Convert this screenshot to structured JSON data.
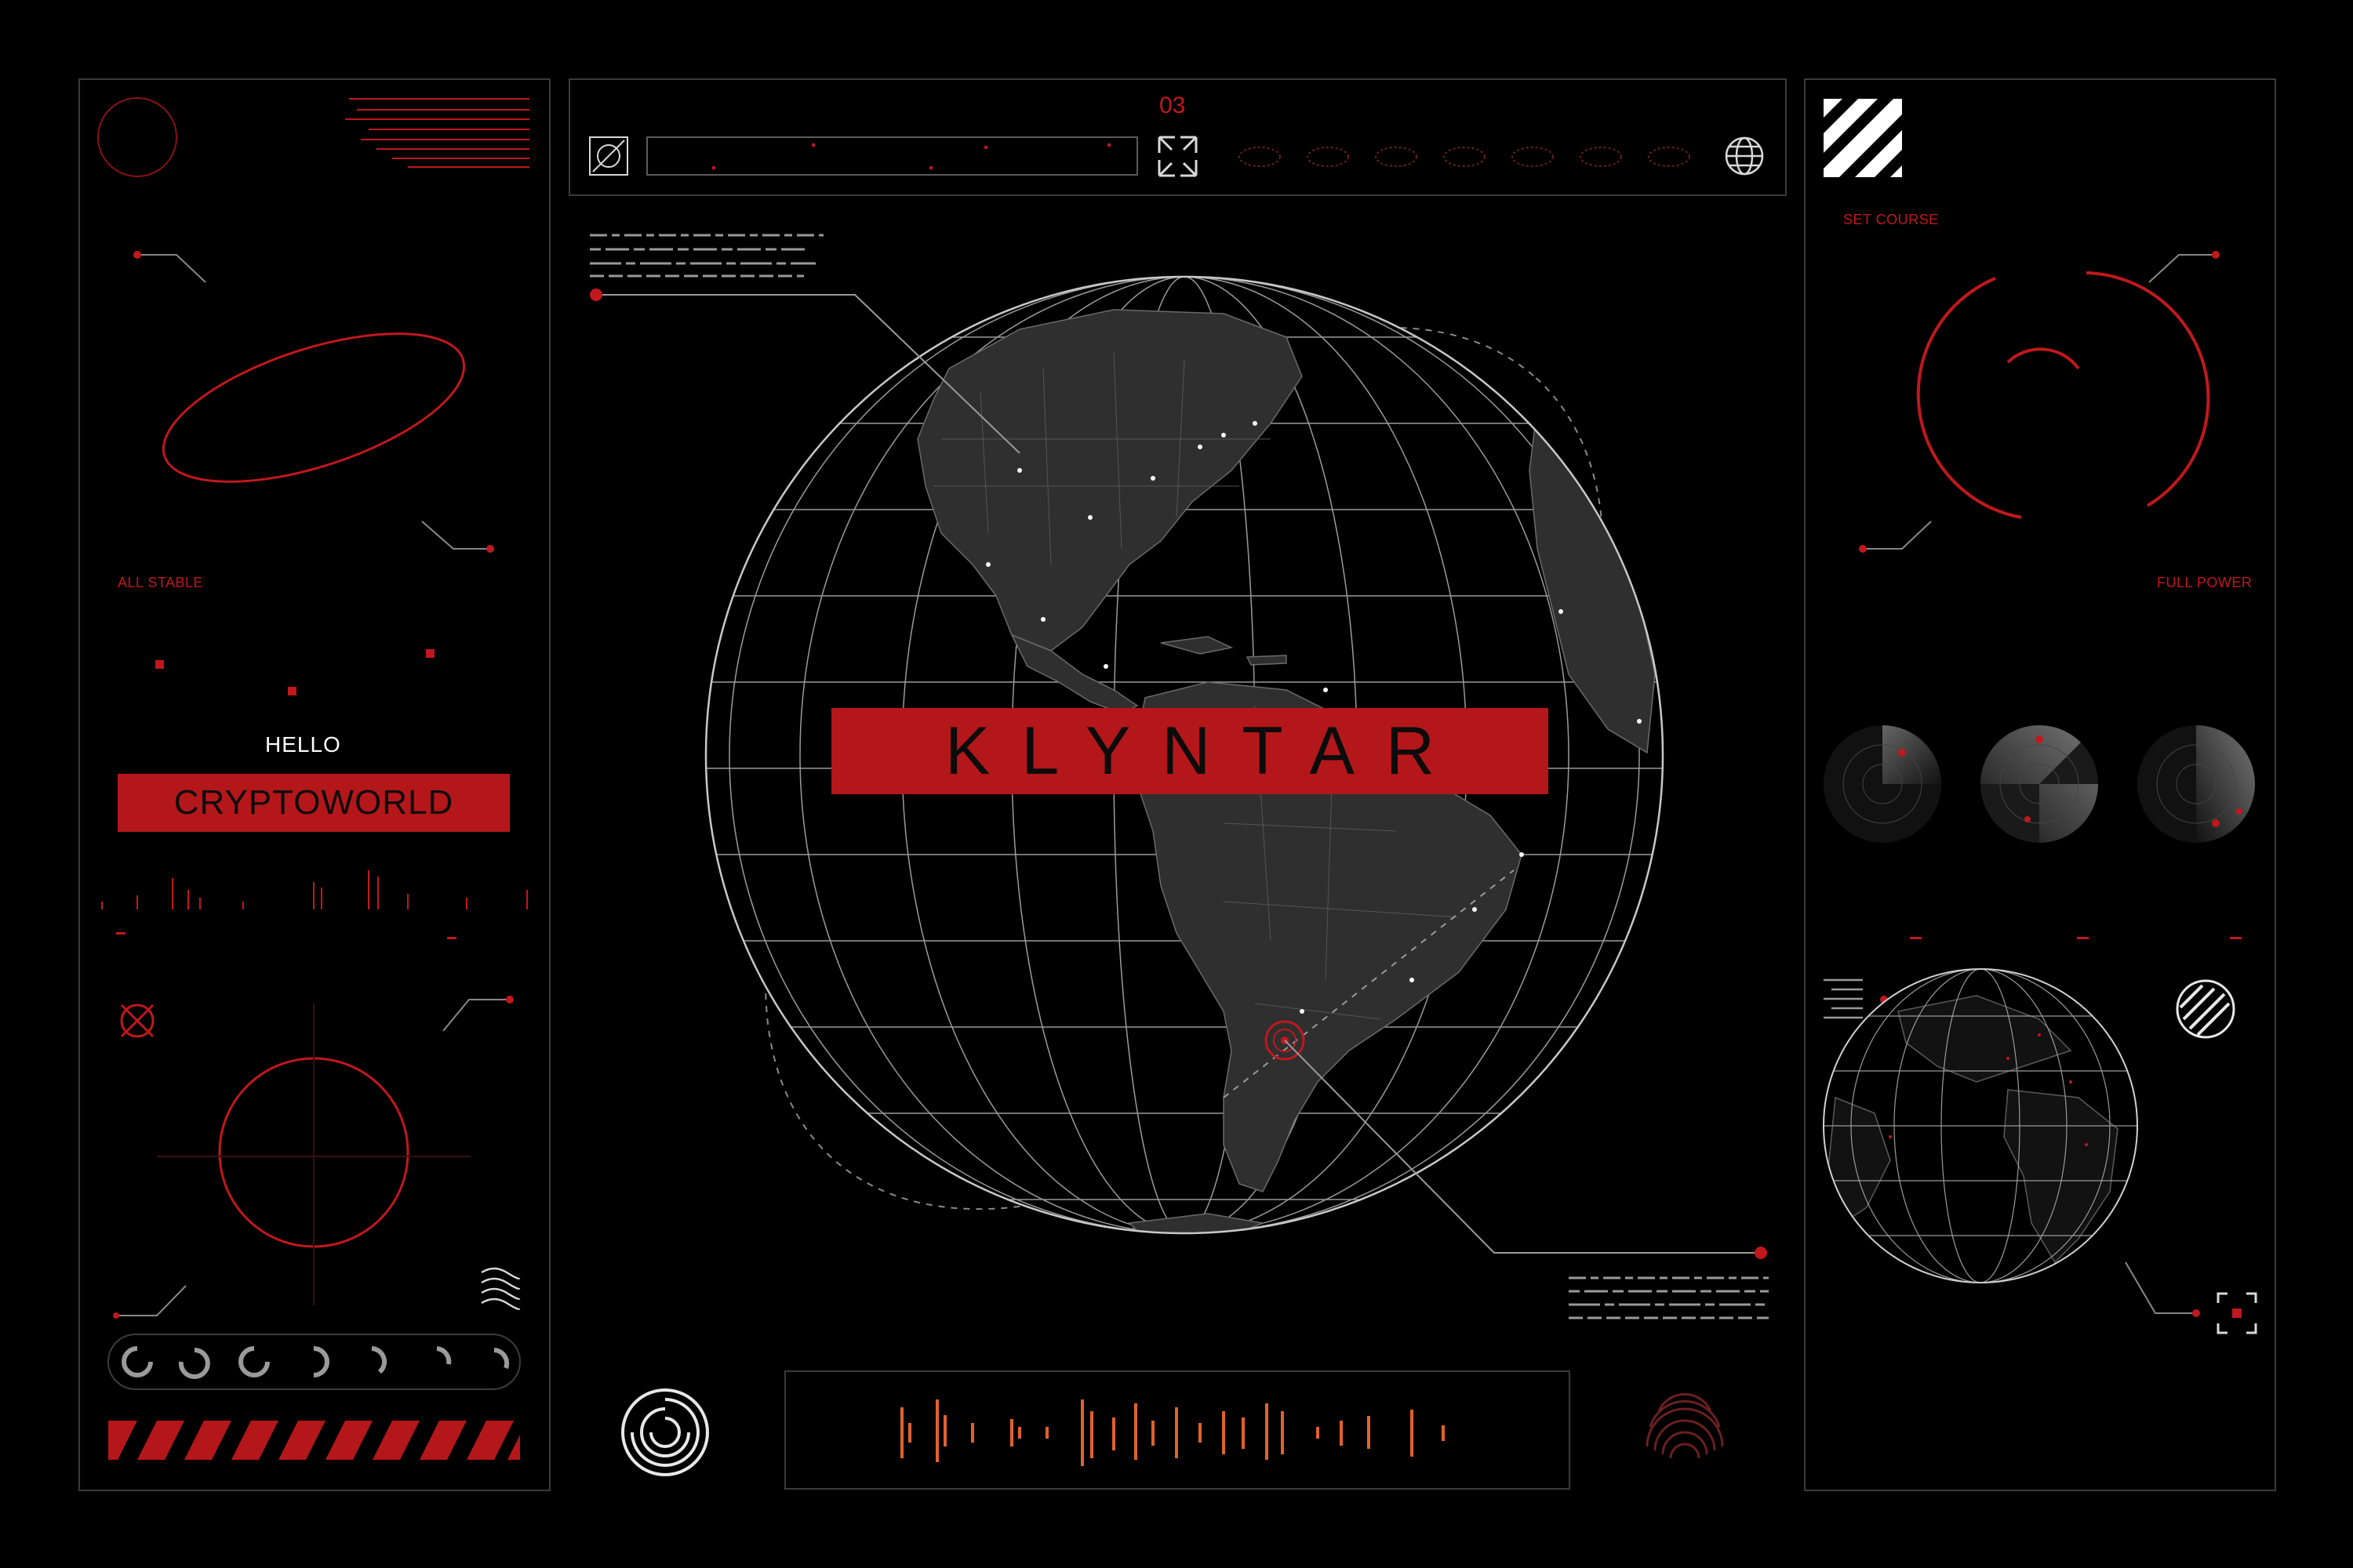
{
  "left_panel": {
    "status": "ALL STABLE",
    "greeting": "HELLO",
    "badge": "CRYPTOWORLD"
  },
  "top_bar": {
    "counter": "03"
  },
  "center": {
    "title": "KLYNTAR"
  },
  "right_panel": {
    "status_left": "SET COURSE",
    "status_right": "FULL POWER"
  },
  "colors": {
    "background": "#000000",
    "accent_red": "#b4171a",
    "line_red": "#c0181d",
    "orange": "#e0622a",
    "panel_border": "#3a3a3a",
    "land": "#303030",
    "grid": "#b8b8b8"
  },
  "icons": {
    "top_left": "crossed-square-icon",
    "top_expand": "expand-arrows-icon",
    "top_globe": "globe-icon",
    "hatched": "hazard-stripes-icon",
    "target": "crosshair-target-icon",
    "waves": "wave-lines-icon",
    "spiral": "spiral-icon",
    "fingerprint": "fingerprint-icon",
    "frame": "focus-frame-icon"
  }
}
